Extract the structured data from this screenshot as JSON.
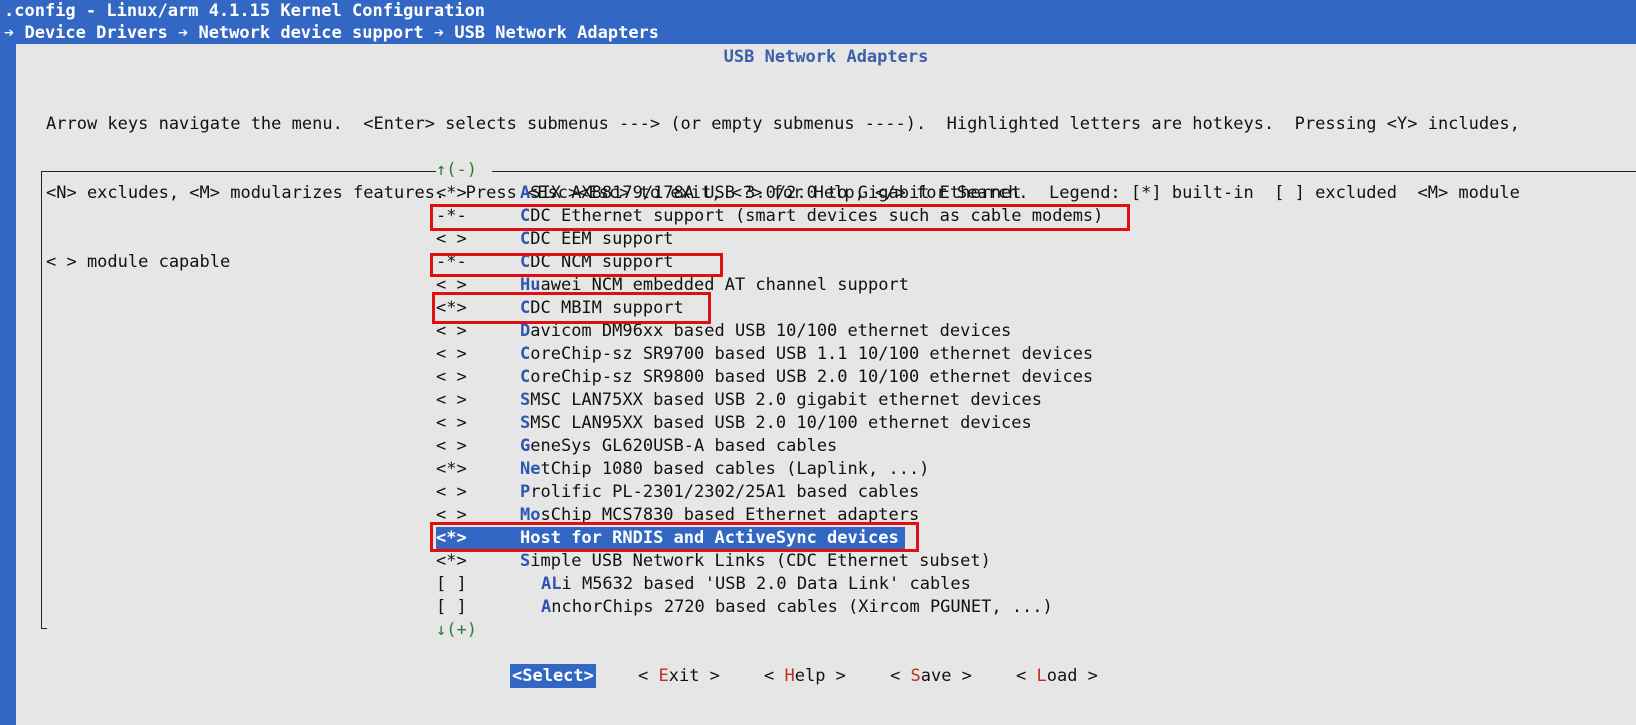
{
  "window": {
    "title": ".config - Linux/arm 4.1.15 Kernel Configuration",
    "breadcrumb": "➔ Device Drivers ➔ Network device support ➔ USB Network Adapters"
  },
  "dialog": {
    "title": "USB Network Adapters",
    "help_lines": [
      "Arrow keys navigate the menu.  <Enter> selects submenus ---> (or empty submenus ----).  Highlighted letters are hotkeys.  Pressing <Y> includes,",
      "<N> excludes, <M> modularizes features.  Press <Esc><Esc> to exit, <?> for Help, </> for Search.  Legend: [*] built-in  [ ] excluded  <M> module",
      "< > module capable"
    ],
    "scroll_up": "↑(-)",
    "scroll_down": "↓(+)"
  },
  "items": [
    {
      "state": "<*>",
      "hot": "A",
      "rest": "SIX AX88179/178A USB 3.0/2.0 to Gigabit Ethernet"
    },
    {
      "state": "-*-",
      "hot": "C",
      "rest": "DC Ethernet support (smart devices such as cable modems)"
    },
    {
      "state": "< >",
      "hot": "C",
      "rest": "DC EEM support"
    },
    {
      "state": "-*-",
      "hot": "C",
      "rest": "DC NCM support"
    },
    {
      "state": "< >",
      "hot": "Hu",
      "rest": "awei NCM embedded AT channel support"
    },
    {
      "state": "<*>",
      "hot": "C",
      "rest": "DC MBIM support"
    },
    {
      "state": "< >",
      "hot": "D",
      "rest": "avicom DM96xx based USB 10/100 ethernet devices"
    },
    {
      "state": "< >",
      "hot": "C",
      "rest": "oreChip-sz SR9700 based USB 1.1 10/100 ethernet devices"
    },
    {
      "state": "< >",
      "hot": "C",
      "rest": "oreChip-sz SR9800 based USB 2.0 10/100 ethernet devices"
    },
    {
      "state": "< >",
      "hot": "S",
      "rest": "MSC LAN75XX based USB 2.0 gigabit ethernet devices"
    },
    {
      "state": "< >",
      "hot": "S",
      "rest": "MSC LAN95XX based USB 2.0 10/100 ethernet devices"
    },
    {
      "state": "< >",
      "hot": "G",
      "rest": "eneSys GL620USB-A based cables"
    },
    {
      "state": "<*>",
      "hot": "Ne",
      "rest": "tChip 1080 based cables (Laplink, ...)"
    },
    {
      "state": "< >",
      "hot": "P",
      "rest": "rolific PL-2301/2302/25A1 based cables"
    },
    {
      "state": "< >",
      "hot": "Mo",
      "rest": "sChip MCS7830 based Ethernet adapters"
    },
    {
      "state": "<*>",
      "hot": "H",
      "rest": "ost for RNDIS and ActiveSync devices"
    },
    {
      "state": "<*>",
      "hot": "S",
      "rest": "imple USB Network Links (CDC Ethernet subset)"
    },
    {
      "state": "[ ]",
      "hot": "AL",
      "rest": "i M5632 based 'USB 2.0 Data Link' cables"
    },
    {
      "state": "[ ]",
      "hot": "A",
      "rest": "nchorChips 2720 based cables (Xircom PGUNET, ...)"
    }
  ],
  "buttons": {
    "select": "<Select>",
    "exit_pre": "< ",
    "exit_hk": "E",
    "exit_rest": "xit >",
    "help_pre": "< ",
    "help_hk": "H",
    "help_rest": "elp >",
    "save_pre": "< ",
    "save_hk": "S",
    "save_rest": "ave >",
    "load_pre": "< ",
    "load_hk": "L",
    "load_rest": "oad >"
  },
  "colors": {
    "background": "#3367c4",
    "dialog": "#e6e6e6",
    "hotkey": "#2f55b0",
    "annotation_box": "#e01010"
  }
}
